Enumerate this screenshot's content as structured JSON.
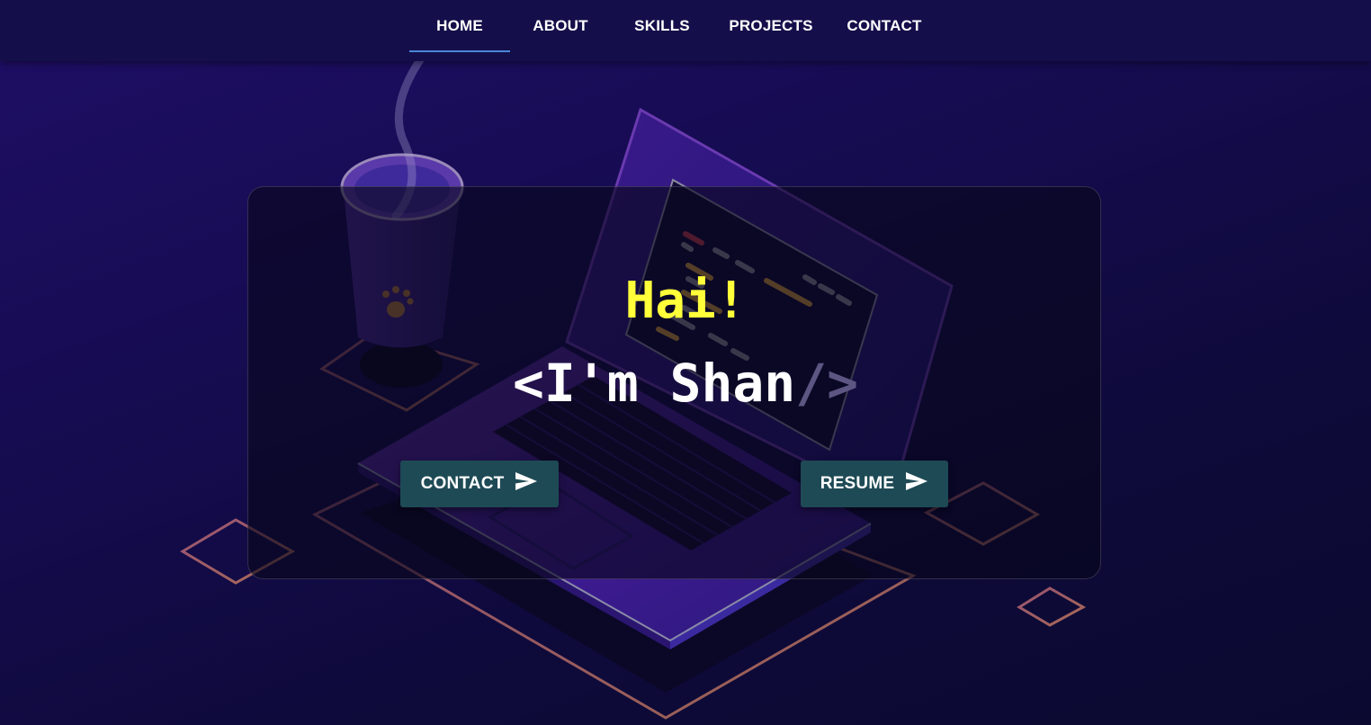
{
  "nav": {
    "items": [
      {
        "label": "HOME",
        "active": true
      },
      {
        "label": "ABOUT",
        "active": false
      },
      {
        "label": "SKILLS",
        "active": false
      },
      {
        "label": "PROJECTS",
        "active": false
      },
      {
        "label": "CONTACT",
        "active": false
      }
    ]
  },
  "hero": {
    "greeting": "Hai!",
    "name_prefix": "<I'm Shan",
    "name_suffix": "/>",
    "buttons": {
      "contact": {
        "label": "CONTACT",
        "icon": "send-icon"
      },
      "resume": {
        "label": "RESUME",
        "icon": "send-icon"
      }
    }
  },
  "colors": {
    "greeting": "#ffff3a",
    "button_bg": "#1e4a55",
    "nav_bg": "#140f4a",
    "active_underline": "#4a86d8"
  }
}
